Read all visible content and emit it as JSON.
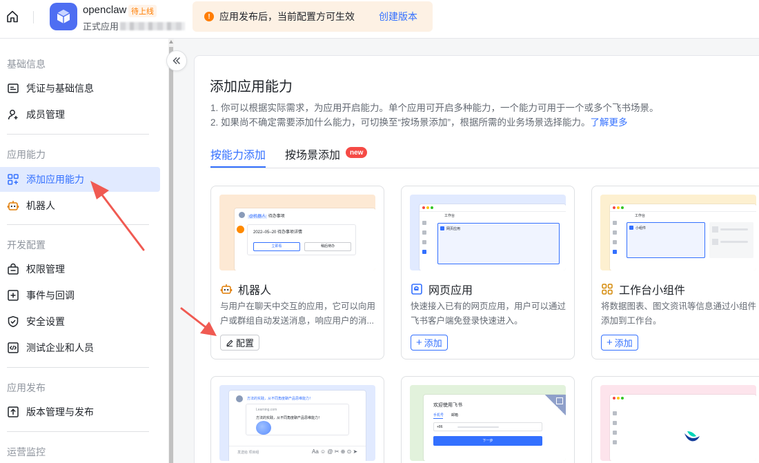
{
  "header": {
    "app_name": "openclaw",
    "app_badge": "待上线",
    "app_type": "正式应用",
    "notice_text": "应用发布后，当前配置方可生效",
    "notice_link": "创建版本"
  },
  "sidebar": {
    "sections": [
      {
        "label": "基础信息"
      },
      {
        "label": "应用能力"
      },
      {
        "label": "开发配置"
      },
      {
        "label": "应用发布"
      },
      {
        "label": "运营监控"
      }
    ],
    "items": [
      {
        "label": "凭证与基础信息",
        "icon": "credential-icon"
      },
      {
        "label": "成员管理",
        "icon": "member-add-icon"
      },
      {
        "label": "添加应用能力",
        "icon": "grid-add-icon",
        "active": true
      },
      {
        "label": "机器人",
        "icon": "robot-icon"
      },
      {
        "label": "权限管理",
        "icon": "permission-icon"
      },
      {
        "label": "事件与回调",
        "icon": "event-icon"
      },
      {
        "label": "安全设置",
        "icon": "shield-icon"
      },
      {
        "label": "测试企业和人员",
        "icon": "test-code-icon"
      },
      {
        "label": "版本管理与发布",
        "icon": "upload-icon"
      }
    ]
  },
  "main": {
    "title": "添加应用能力",
    "desc1": "1. 你可以根据实际需求，为应用开启能力。单个应用可开启多种能力，一个能力可用于一个或多个飞书场景。",
    "desc2": "2. 如果尚不确定需要添加什么能力，可切换至“按场景添加”，根据所需的业务场景选择能力。",
    "desc2_link": "了解更多",
    "tabs": [
      {
        "label": "按能力添加",
        "active": true
      },
      {
        "label": "按场景添加",
        "badge": "new"
      }
    ],
    "cards": [
      {
        "title": "机器人",
        "desc": "与用户在聊天中交互的应用，它可以向用户或群组自动发送消息，响应用户的消...",
        "button": "配置",
        "icon": "robot-icon",
        "preview": {
          "bg": "#fde9d4",
          "mention": "@机器人",
          "mention_suffix": "待办事项",
          "line": "2022–05–20 待办事项详情",
          "btn1": "立即看",
          "btn2": "稍后待办"
        }
      },
      {
        "title": "网页应用",
        "desc": "快速接入已有的网页应用，用户可以通过飞书客户端免登录快速进入。",
        "button": "添加",
        "icon": "web-app-icon",
        "preview": {
          "bg": "#e1eaff",
          "tab": "工作台",
          "label": "网页应用"
        }
      },
      {
        "title": "工作台小组件",
        "desc": "将数据图表、图文资讯等信息通过小组件添加到工作台。",
        "button": "添加",
        "icon": "widget-icon",
        "preview": {
          "bg": "#fdf0d0",
          "tab": "工作台",
          "label": "小组件"
        }
      },
      {
        "preview": {
          "bg": "#e1eaff",
          "banner": "方法的实践，从不同角度聊产品思维能力！",
          "site": "Learning.com",
          "link_text": "方法的实践，从不同角度聊产品思维能力！",
          "input": "发送给 项目组"
        }
      },
      {
        "preview": {
          "bg": "#e2f2dc",
          "welcome": "欢迎使用飞书",
          "tab1": "手机号",
          "tab2": "邮箱",
          "code": "+86",
          "next": "下一步"
        }
      },
      {
        "preview": {
          "bg": "#fde4ec"
        }
      }
    ]
  },
  "colors": {
    "accent": "#3370ff",
    "warning": "#ff7d00",
    "new_badge": "#f54a45",
    "annotation_arrow": "#f05a52"
  }
}
